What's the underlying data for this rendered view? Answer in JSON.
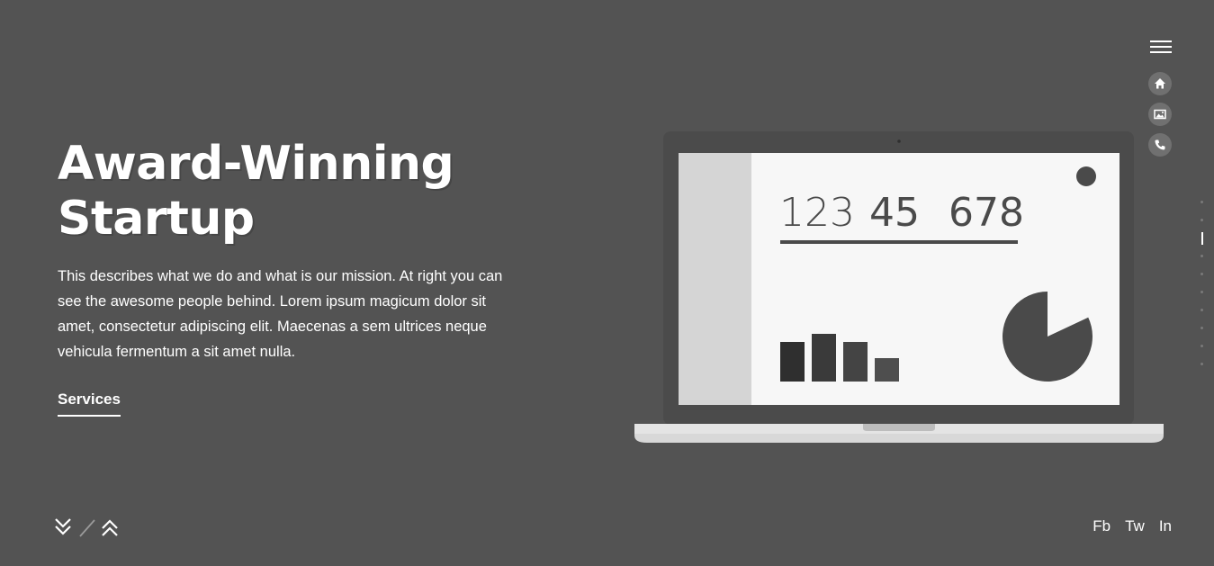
{
  "hero": {
    "title_line1": "Award-Winning",
    "title_line2": "Startup",
    "description": "This describes what we do and what is our mission. At right you can see the awesome people behind. Lorem ipsum magicum dolor sit amet, consectetur adipiscing elit. Maecenas a sem ultrices neque vehicula fermentum a sit amet nulla.",
    "cta_label": "Services"
  },
  "nav": {
    "menu_icon": "hamburger-icon",
    "icons": [
      "home-icon",
      "gallery-icon",
      "phone-icon"
    ],
    "page_dots_total": 10,
    "page_dots_active_index": 2
  },
  "laptop_screen": {
    "numbers": [
      "123",
      "45",
      "678"
    ],
    "bar_values": [
      44,
      53,
      44,
      26
    ],
    "pie_fraction_missing": 0.3
  },
  "scroll_nav": {
    "down_icon": "double-chevron-down-icon",
    "up_icon": "double-chevron-up-icon"
  },
  "social": {
    "facebook": "Fb",
    "twitter": "Tw",
    "linkedin": "In"
  },
  "colors": {
    "background": "#535353",
    "screen": "#f7f7f7",
    "sidebar": "#d5d5d5",
    "ink": "#4a4a4a"
  }
}
